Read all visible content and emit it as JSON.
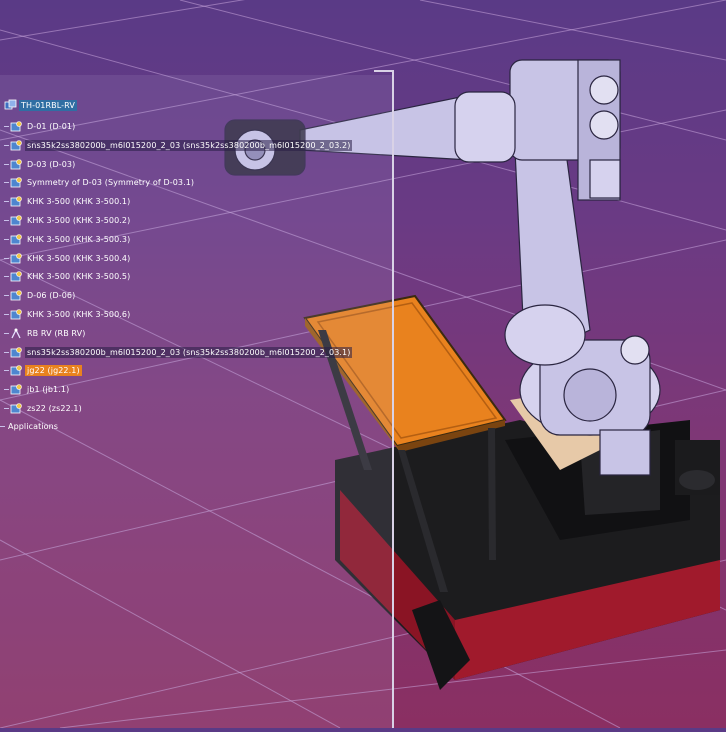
{
  "tree": {
    "root": {
      "label": "TH-01RBL-RV",
      "icon": "product-icon"
    },
    "items": [
      {
        "label": "D-01 (D-01)",
        "icon": "part-icon",
        "style": "plain"
      },
      {
        "label": "sns35k2ss380200b_m6l015200_2_03 (sns35k2ss380200b_m6l015200_2_03.2)",
        "icon": "part-icon",
        "style": "dark"
      },
      {
        "label": "D-03 (D-03)",
        "icon": "part-icon",
        "style": "plain"
      },
      {
        "label": "Symmetry of D-03 (Symmetry of D-03.1)",
        "icon": "part-icon",
        "style": "plain"
      },
      {
        "label": "KHK 3-500 (KHK 3-500.1)",
        "icon": "part-icon",
        "style": "plain"
      },
      {
        "label": "KHK 3-500 (KHK 3-500.2)",
        "icon": "part-icon",
        "style": "plain"
      },
      {
        "label": "KHK 3-500 (KHK 3-500.3)",
        "icon": "part-icon",
        "style": "plain"
      },
      {
        "label": "KHK 3-500 (KHK 3-500.4)",
        "icon": "part-icon",
        "style": "plain"
      },
      {
        "label": "KHK 3-500 (KHK 3-500.5)",
        "icon": "part-icon",
        "style": "plain"
      },
      {
        "label": "D-06 (D-06)",
        "icon": "part-icon",
        "style": "plain"
      },
      {
        "label": "KHK 3-500 (KHK 3-500.6)",
        "icon": "part-icon",
        "style": "plain"
      },
      {
        "label": "RB RV (RB RV)",
        "icon": "assembly-icon",
        "style": "plain"
      },
      {
        "label": "sns35k2ss380200b_m6l015200_2_03 (sns35k2ss380200b_m6l015200_2_03.1)",
        "icon": "part-icon",
        "style": "dark"
      },
      {
        "label": "jg22 (jg22.1)",
        "icon": "part-icon",
        "style": "orange"
      },
      {
        "label": "jb1 (jb1.1)",
        "icon": "part-icon",
        "style": "plain"
      },
      {
        "label": "zs22 (zs22.1)",
        "icon": "part-icon",
        "style": "plain"
      }
    ],
    "applications": {
      "label": "Applications",
      "icon": "applications-icon"
    }
  },
  "colors": {
    "background_top": "#5a3a86",
    "background_bottom": "#8a2f62",
    "selection_blue": "#2f6ea3",
    "selection_orange": "#e9821e",
    "table_top": "#e9821e",
    "base_red": "#8a1424",
    "base_black": "#1c1c1e",
    "robot_body": "#c8c4e6"
  }
}
